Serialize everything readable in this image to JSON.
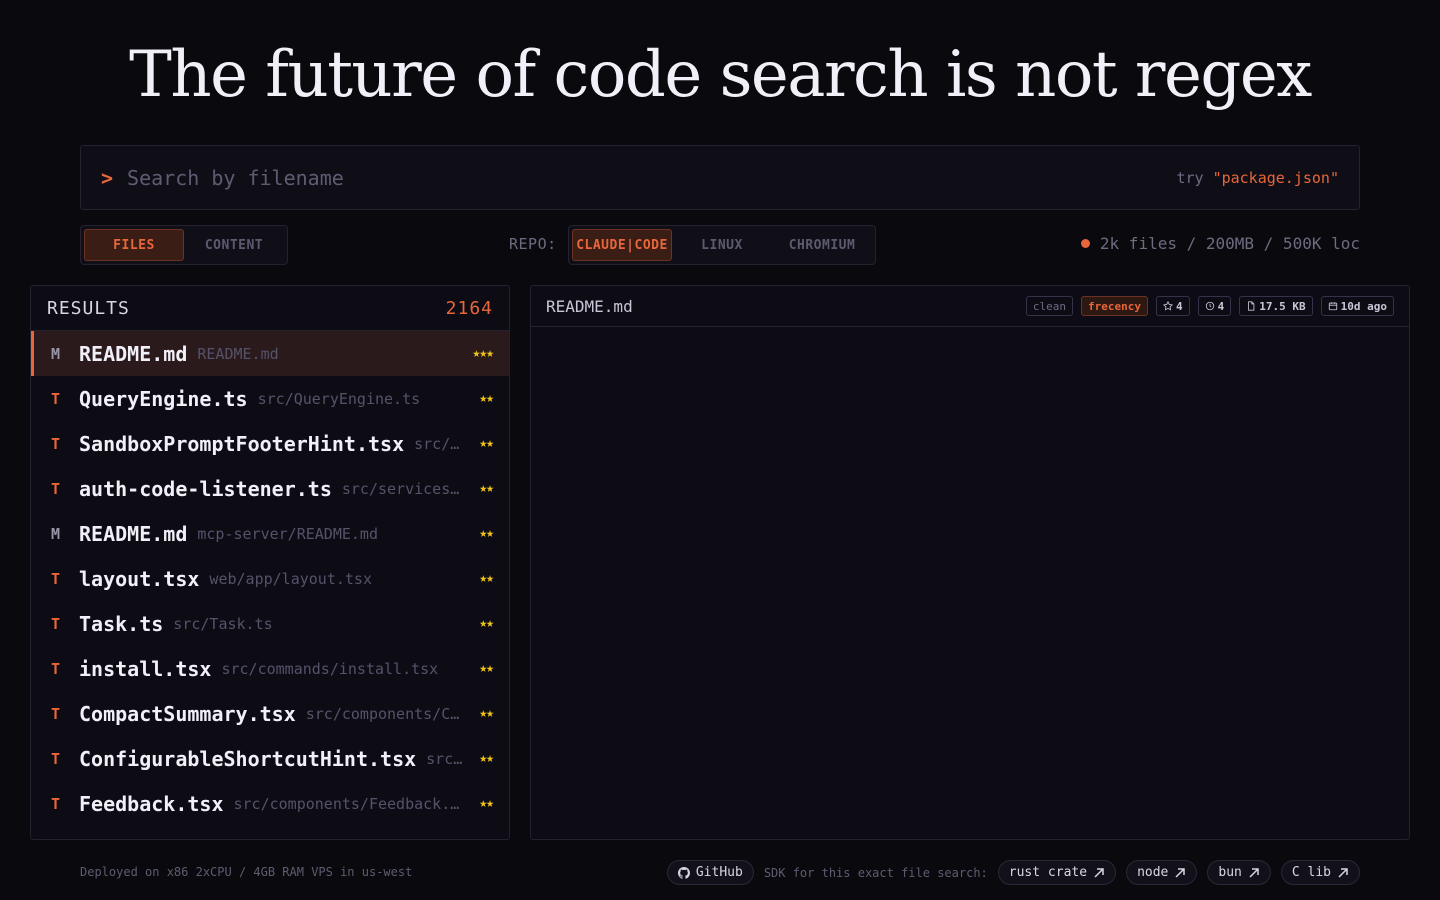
{
  "headline": "The future of code search is not regex",
  "search": {
    "prompt": ">",
    "placeholder": "Search by filename",
    "hint_prefix": "try ",
    "hint_query": "\"package.json\""
  },
  "mode_toggle": {
    "files": "FILES",
    "content": "CONTENT",
    "active": "FILES"
  },
  "repo": {
    "label": "REPO:",
    "options": [
      "CLAUDE|CODE",
      "LINUX",
      "CHROMIUM"
    ],
    "active": "CLAUDE|CODE"
  },
  "stats": "2k files / 200MB / 500K loc",
  "results": {
    "title": "RESULTS",
    "count": "2164",
    "items": [
      {
        "type": "M",
        "name": "README.md",
        "path": "README.md",
        "stars": "★★★"
      },
      {
        "type": "T",
        "name": "QueryEngine.ts",
        "path": "src/QueryEngine.ts",
        "stars": "★★"
      },
      {
        "type": "T",
        "name": "SandboxPromptFooterHint.tsx",
        "path": "src/…",
        "stars": "★★"
      },
      {
        "type": "T",
        "name": "auth-code-listener.ts",
        "path": "src/services…",
        "stars": "★★"
      },
      {
        "type": "M",
        "name": "README.md",
        "path": "mcp-server/README.md",
        "stars": "★★"
      },
      {
        "type": "T",
        "name": "layout.tsx",
        "path": "web/app/layout.tsx",
        "stars": "★★"
      },
      {
        "type": "T",
        "name": "Task.ts",
        "path": "src/Task.ts",
        "stars": "★★"
      },
      {
        "type": "T",
        "name": "install.tsx",
        "path": "src/commands/install.tsx",
        "stars": "★★"
      },
      {
        "type": "T",
        "name": "CompactSummary.tsx",
        "path": "src/components/C…",
        "stars": "★★"
      },
      {
        "type": "T",
        "name": "ConfigurableShortcutHint.tsx",
        "path": "src…",
        "stars": "★★"
      },
      {
        "type": "T",
        "name": "Feedback.tsx",
        "path": "src/components/Feedback.…",
        "stars": "★★"
      }
    ]
  },
  "preview": {
    "filename": "README.md",
    "badges": {
      "clean": "clean",
      "frecency": "frecency",
      "stars": "4",
      "history": "4",
      "size": "17.5 KB",
      "modified": "10d ago"
    }
  },
  "footer": {
    "deployed": "Deployed on x86 2xCPU / 4GB RAM VPS in us-west",
    "github": "GitHub",
    "sdk_label": "SDK for this exact file search:",
    "links": [
      "rust crate",
      "node",
      "bun",
      "C lib"
    ]
  },
  "colors": {
    "accent": "#e8663a",
    "background": "#0a090d",
    "panel": "#0d0c14",
    "star": "#f0c419"
  }
}
